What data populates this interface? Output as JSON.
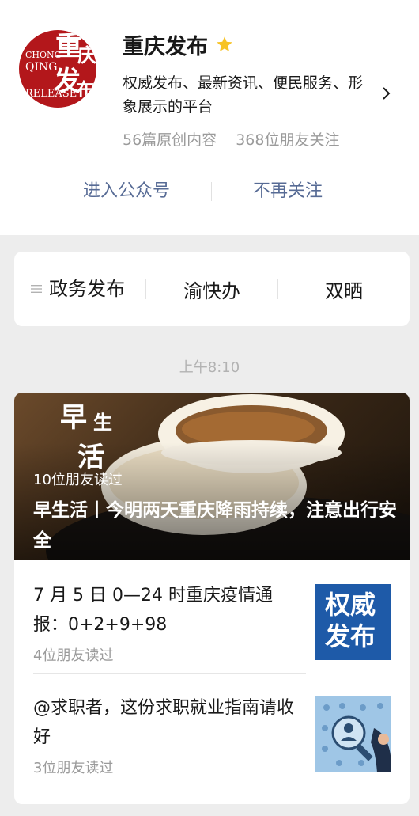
{
  "account": {
    "logo_text": {
      "line1": "重",
      "line2": "庆",
      "line3": "发",
      "line4": "布",
      "small1": "CHONG",
      "small2": "QING",
      "small3": "RELEASE"
    },
    "name": "重庆发布",
    "description": "权威发布、最新资讯、便民服务、形象展示的平台",
    "original_count": "56篇原创内容",
    "followers": "368位朋友关注",
    "enter_label": "进入公众号",
    "unfollow_label": "不再关注",
    "star_color": "#f7c325",
    "link_color": "#576b95"
  },
  "menu": {
    "items": [
      {
        "label": "政务发布"
      },
      {
        "label": "渝快办"
      },
      {
        "label": "双晒"
      }
    ]
  },
  "timestamp": "上午8:10",
  "article": {
    "cover": {
      "brand1": "早",
      "brand2": "生",
      "brand3": "活",
      "reads": "10位朋友读过",
      "title": "早生活丨今明两天重庆降雨持续，注意出行安全"
    },
    "items": [
      {
        "title": "7 月 5 日 0—24 时重庆疫情通报：0+2+9+98",
        "reads": "4位朋友读过",
        "thumb_text1": "权威",
        "thumb_text2": "发布"
      },
      {
        "title": "@求职者，这份求职就业指南请收好",
        "reads": "3位朋友读过"
      }
    ]
  }
}
